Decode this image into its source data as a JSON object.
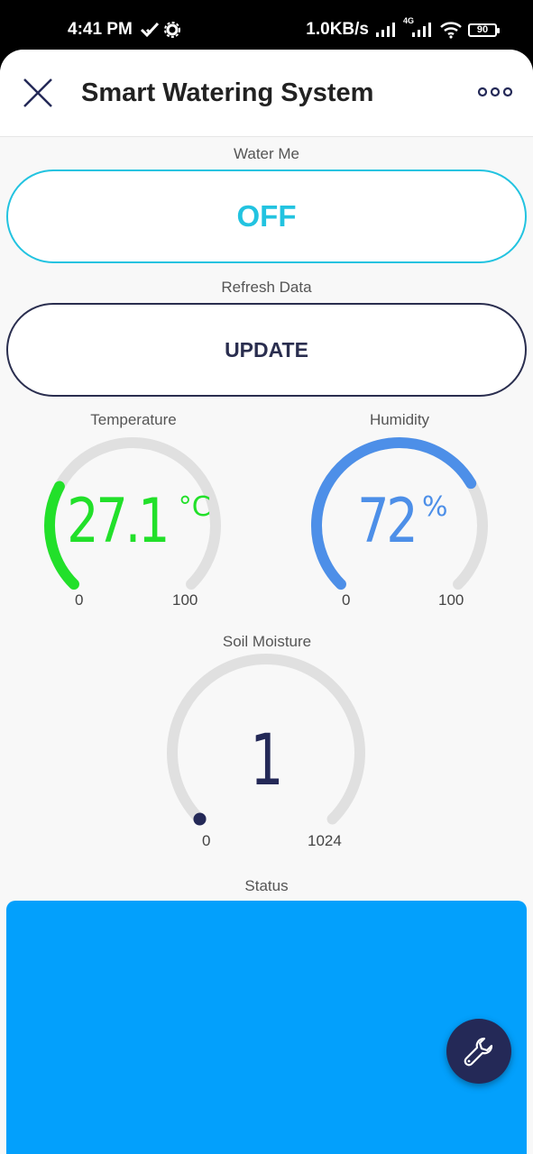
{
  "status_bar": {
    "time": "4:41 PM",
    "network_speed": "1.0KB/s",
    "network_type": "4G",
    "battery": "90"
  },
  "header": {
    "title": "Smart Watering System",
    "close_icon": "close-icon",
    "more_icon": "more-horizontal-icon"
  },
  "water_me": {
    "label": "Water Me",
    "button_text": "OFF",
    "color": "#22c3e0"
  },
  "refresh": {
    "label": "Refresh Data",
    "button_text": "UPDATE",
    "color": "#2a2e4f"
  },
  "temperature": {
    "label": "Temperature",
    "value": "27.1",
    "unit": "°C",
    "numeric_value": 27.1,
    "min": "0",
    "max": "100",
    "range": [
      0,
      100
    ],
    "color": "#22e02a"
  },
  "humidity": {
    "label": "Humidity",
    "value": "72",
    "unit": "%",
    "numeric_value": 72,
    "min": "0",
    "max": "100",
    "range": [
      0,
      100
    ],
    "color": "#4d8fe8"
  },
  "soil_moisture": {
    "label": "Soil Moisture",
    "value": "1",
    "numeric_value": 1,
    "min": "0",
    "max": "1024",
    "range": [
      0,
      1024
    ],
    "color": "#242957"
  },
  "status": {
    "label": "Status",
    "color": "#03a0fc"
  },
  "fab_icon": "wrench-icon"
}
